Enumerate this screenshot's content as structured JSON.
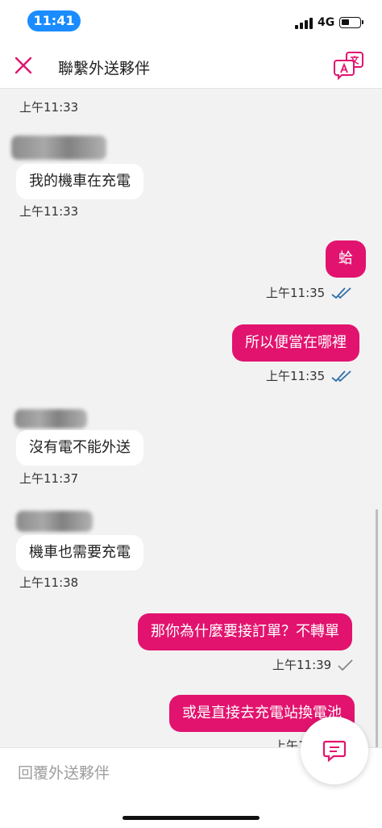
{
  "status_bar": {
    "time": "11:41",
    "network": "4G"
  },
  "header": {
    "title": "聯繫外送夥伴"
  },
  "messages": [
    {
      "direction": "in",
      "text": "",
      "time": "上午11:33"
    },
    {
      "direction": "in",
      "text": "我的機車在充電",
      "time": "上午11:33"
    },
    {
      "direction": "out",
      "text": "蛤",
      "time": "上午11:35",
      "status": "read"
    },
    {
      "direction": "out",
      "text": "所以便當在哪裡",
      "time": "上午11:35",
      "status": "read"
    },
    {
      "direction": "in",
      "text": "沒有電不能外送",
      "time": "上午11:37"
    },
    {
      "direction": "in",
      "text": "機車也需要充電",
      "time": "上午11:38"
    },
    {
      "direction": "out",
      "text": "那你為什麼要接訂單？不轉單",
      "time": "上午11:39",
      "status": "sent"
    },
    {
      "direction": "out",
      "text": "或是直接去充電站換電池",
      "time": "上午1",
      "status": "sent"
    }
  ],
  "input": {
    "placeholder": "回覆外送夥伴"
  },
  "colors": {
    "accent": "#e2136e",
    "time_pill": "#1a8cff",
    "read_tick": "#2f6fa8"
  },
  "icons": {
    "close": "close-icon",
    "translate": "translate-icon",
    "read": "double-check-icon",
    "sent": "check-icon",
    "quick_reply": "chat-bubble-icon"
  }
}
